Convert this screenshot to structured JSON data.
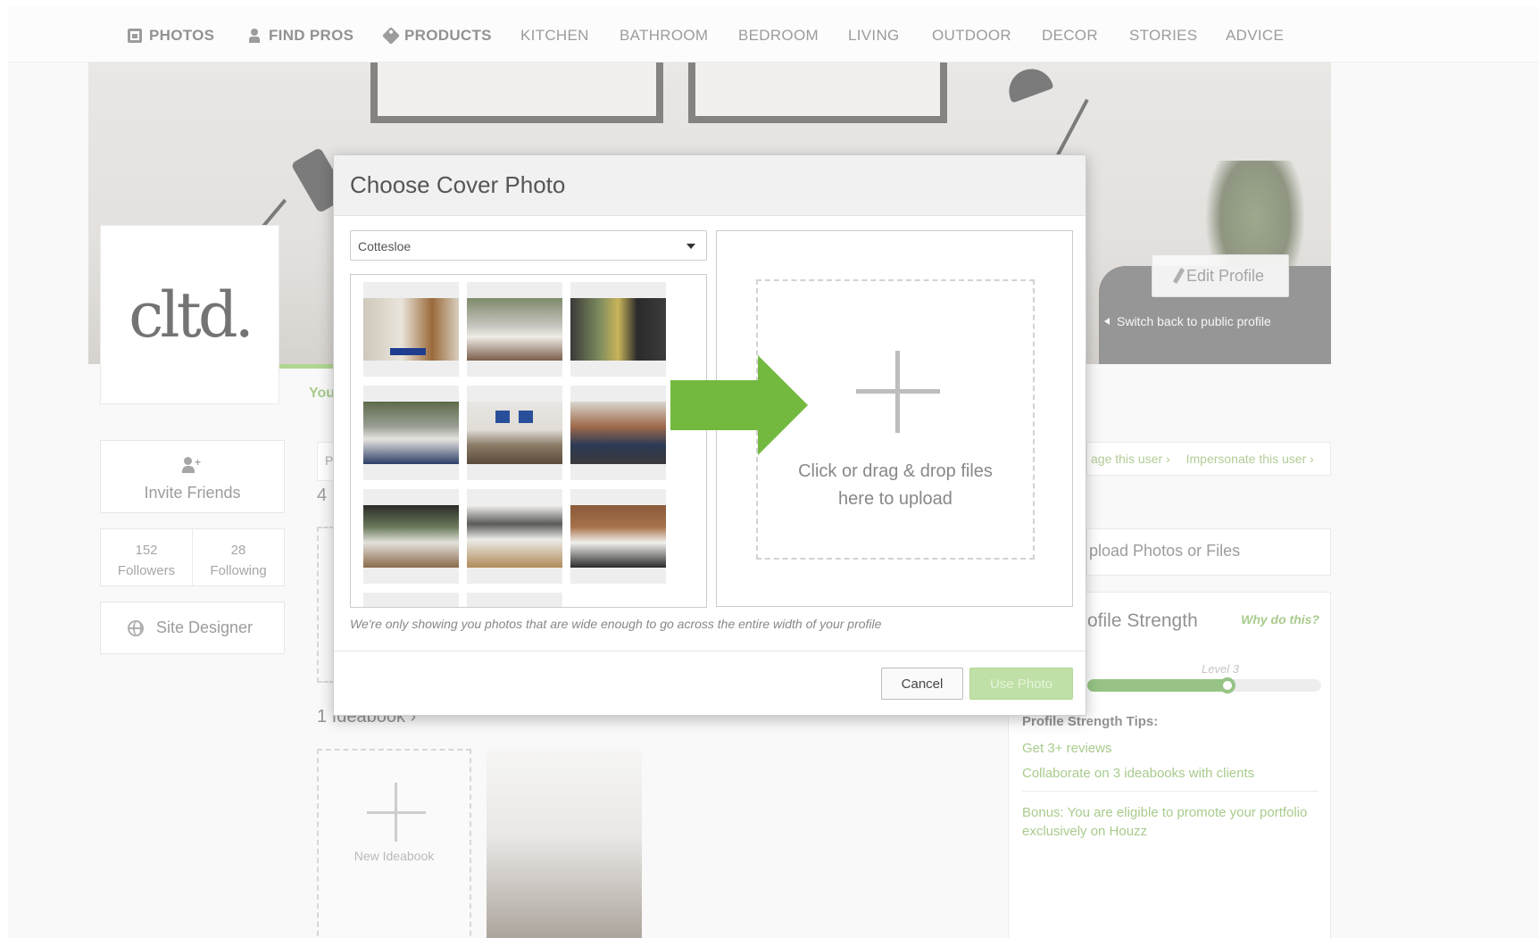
{
  "nav": {
    "items": [
      {
        "label": "PHOTOS",
        "icon": "photos-icon",
        "bold": true
      },
      {
        "label": "FIND PROS",
        "icon": "person-icon",
        "bold": true
      },
      {
        "label": "PRODUCTS",
        "icon": "tag-icon",
        "bold": true
      },
      {
        "label": "KITCHEN"
      },
      {
        "label": "BATHROOM"
      },
      {
        "label": "BEDROOM"
      },
      {
        "label": "LIVING"
      },
      {
        "label": "OUTDOOR"
      },
      {
        "label": "DECOR"
      },
      {
        "label": "STORIES"
      },
      {
        "label": "ADVICE"
      }
    ]
  },
  "profile": {
    "logo_text": "cltd.",
    "you_text": "You",
    "edit_profile_label": "Edit Profile",
    "switch_back_label": "Switch back to public profile",
    "invite_label": "Invite Friends",
    "followers_count": "152",
    "followers_label": "Followers",
    "following_count": "28",
    "following_label": "Following",
    "site_designer_label": "Site Designer",
    "tab_letter": "P",
    "count_four": "4",
    "ideabook_heading": "1 Ideabook ›",
    "new_ideabook_label": "New Ideabook"
  },
  "right_panel": {
    "manage_link": "age this user ›",
    "impersonate_link": "Impersonate this user ›",
    "upload_label": "pload Photos or Files",
    "strength_title": "ofile Strength",
    "why_link": "Why do this?",
    "level_label": "Level 3",
    "strength_fraction": 0.6,
    "tips_title": "Profile Strength Tips:",
    "tips": [
      "Get 3+ reviews",
      "Collaborate on 3 ideabooks with clients"
    ],
    "bonus": "Bonus: You are eligible to promote your portfolio exclusively on Houzz"
  },
  "modal": {
    "title": "Choose Cover Photo",
    "album_selected": "Cottesloe",
    "photos": [
      "living-room-blue-rug",
      "bedroom-grey",
      "patio-dark",
      "bedroom-window",
      "bedroom-blue-prints",
      "living-room-patterned",
      "dining-dark-window",
      "dining-white",
      "kitchen-wood"
    ],
    "upload_text_line1": "Click or drag & drop files",
    "upload_text_line2": "here to upload",
    "note": "We're only showing you photos that are wide enough to go across the entire width of your profile",
    "cancel_label": "Cancel",
    "use_photo_label": "Use Photo"
  },
  "colors": {
    "accent_green": "#77b844",
    "arrow_green": "#74b93f",
    "link_green": "#6aa53a"
  }
}
